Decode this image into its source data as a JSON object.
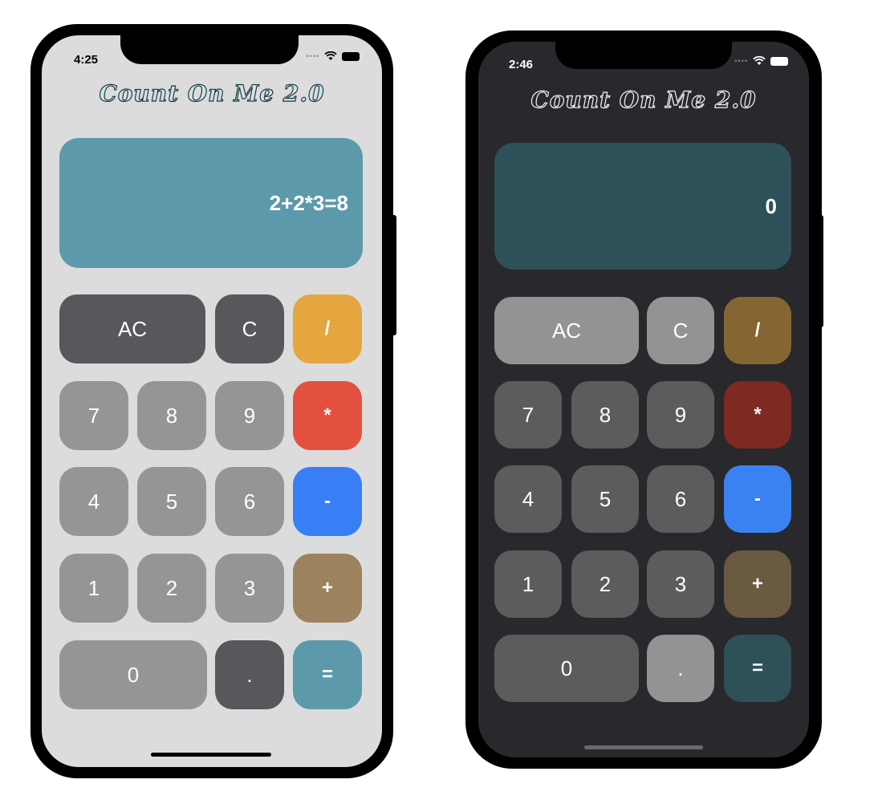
{
  "light": {
    "status_time": "4:25",
    "title": "Count On Me 2.0",
    "display_text": "2+2*3=8",
    "colors": {
      "screen": "#dcdcdc",
      "display": "#5c9aab",
      "dark_key": "#56585c",
      "digit_key": "#959595",
      "divide": "#e5a640",
      "multiply": "#e4503f",
      "minus": "#387ef5",
      "plus": "#9c825e",
      "equals": "#5c9aab"
    }
  },
  "dark": {
    "status_time": "2:46",
    "title": "Count On Me 2.0",
    "display_text": "0",
    "colors": {
      "screen": "#29282c",
      "display": "#2e5058",
      "func_key": "#939393",
      "digit_key": "#5c5c5c",
      "divide": "#856632",
      "multiply": "#7d2a22",
      "minus": "#3a82f2",
      "plus": "#6a5a41",
      "equals": "#2e5058"
    }
  },
  "keys": {
    "ac": "AC",
    "c": "C",
    "divide": "/",
    "multiply": "*",
    "minus": "-",
    "plus": "+",
    "equals": "=",
    "dot": ".",
    "d0": "0",
    "d1": "1",
    "d2": "2",
    "d3": "3",
    "d4": "4",
    "d5": "5",
    "d6": "6",
    "d7": "7",
    "d8": "8",
    "d9": "9"
  }
}
